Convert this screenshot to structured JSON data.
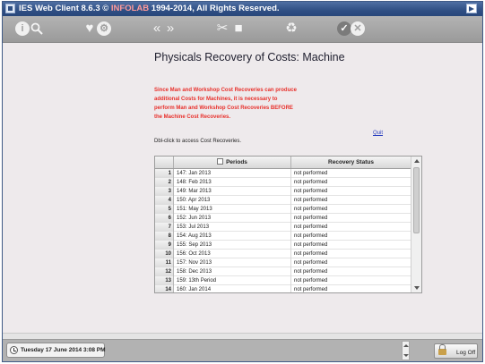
{
  "window": {
    "title": "IES Web Client 8.6.3 © ",
    "brand": "INFOLAB",
    "title_suffix": " 1994-2014, All Rights Reserved."
  },
  "toolbar": {
    "icons": [
      "info-icon",
      "search-icon",
      "favorite-icon",
      "settings-icon",
      "back-icon",
      "forward-icon",
      "tools-icon",
      "stop-icon",
      "recycle-icon",
      "ok-icon",
      "cancel-icon"
    ]
  },
  "page": {
    "title": "Physicals Recovery of Costs: Machine",
    "warning": "Since Man and Workshop Cost Recoveries can produce additional Costs for Machines, it is necessary to perform Man and Workshop Cost Recoveries BEFORE the Machine Cost Recoveries.",
    "quit": "Quit",
    "hint": "Dbl-click to access Cost Recoveries."
  },
  "table": {
    "columns": [
      "Periods",
      "Recovery Status"
    ],
    "rows": [
      {
        "n": "1",
        "period": "147: Jan 2013",
        "status": "not performed"
      },
      {
        "n": "2",
        "period": "148: Feb 2013",
        "status": "not performed"
      },
      {
        "n": "3",
        "period": "149: Mar 2013",
        "status": "not performed"
      },
      {
        "n": "4",
        "period": "150: Apr 2013",
        "status": "not performed"
      },
      {
        "n": "5",
        "period": "151: May 2013",
        "status": "not performed"
      },
      {
        "n": "6",
        "period": "152: Jun 2013",
        "status": "not performed"
      },
      {
        "n": "7",
        "period": "153: Jul 2013",
        "status": "not performed"
      },
      {
        "n": "8",
        "period": "154: Aug 2013",
        "status": "not performed"
      },
      {
        "n": "9",
        "period": "155: Sep 2013",
        "status": "not performed"
      },
      {
        "n": "10",
        "period": "156: Oct 2013",
        "status": "not performed"
      },
      {
        "n": "11",
        "period": "157: Nov 2013",
        "status": "not performed"
      },
      {
        "n": "12",
        "period": "158: Dec 2013",
        "status": "not performed"
      },
      {
        "n": "13",
        "period": "159: 13th Period",
        "status": "not performed"
      },
      {
        "n": "14",
        "period": "160: Jan 2014",
        "status": "not performed"
      }
    ]
  },
  "footer": {
    "datetime": "Tuesday 17 June 2014 3:08 PM",
    "logoff": "Log Off"
  },
  "colors": {
    "titlebar": "#2f4f84",
    "toolbar": "#a8a8a8",
    "warning": "#e8302b",
    "link": "#2a3fbf"
  }
}
